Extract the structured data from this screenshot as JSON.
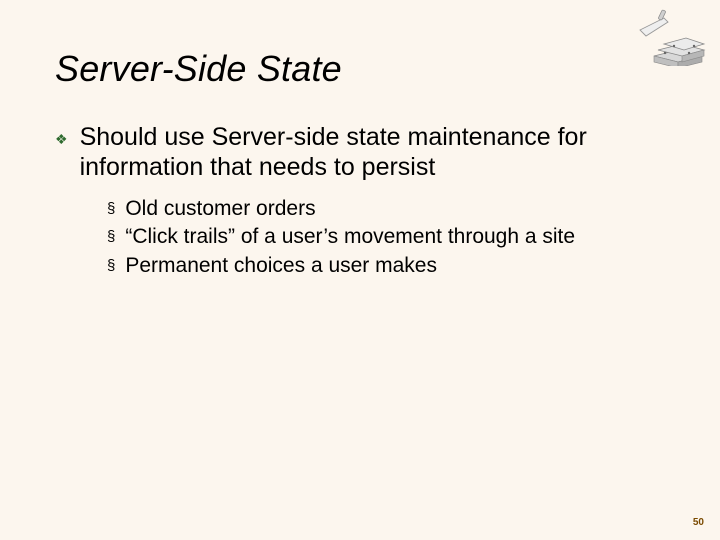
{
  "title": "Server-Side State",
  "bullet": {
    "text": "Should use Server-side state maintenance for information that needs to persist",
    "sub": [
      "Old customer orders",
      "“Click trails” of a user’s movement through a site",
      "Permanent choices a user makes"
    ]
  },
  "pageNumber": "50"
}
